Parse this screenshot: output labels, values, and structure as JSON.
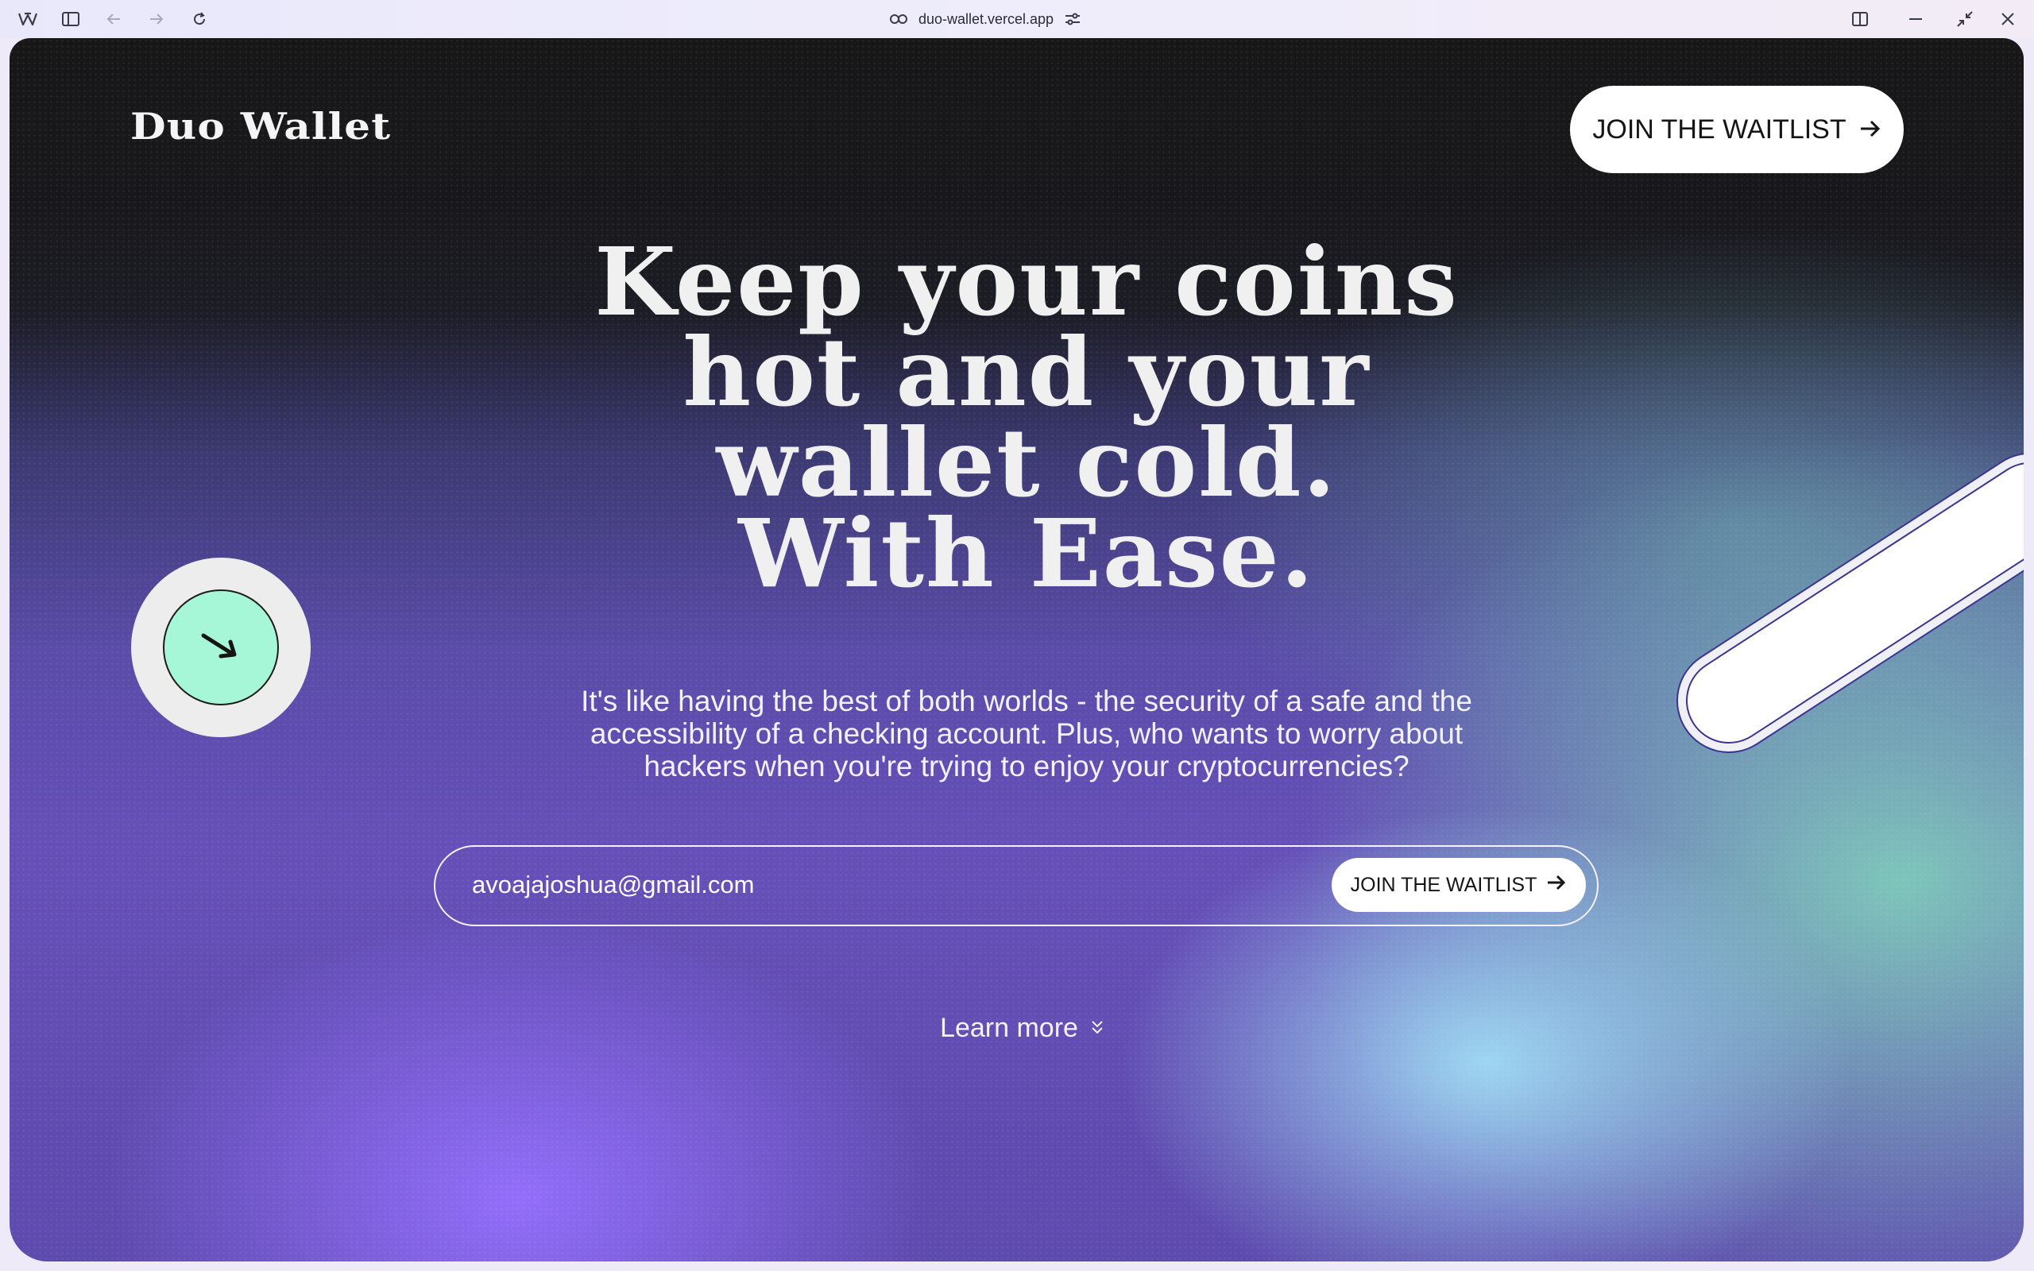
{
  "browser": {
    "url": "duo-wallet.vercel.app",
    "icons": [
      "app-logo-icon",
      "sidebar-toggle-icon",
      "back-icon",
      "forward-icon",
      "reload-icon",
      "link-icon",
      "site-settings-icon",
      "split-view-icon",
      "minimize-icon",
      "restore-icon",
      "close-icon"
    ]
  },
  "header": {
    "logo": "Duo Wallet",
    "cta_label": "JOIN THE WAITLIST"
  },
  "hero": {
    "lines": [
      "Keep your coins",
      "hot and your",
      "wallet cold.",
      "With Ease."
    ]
  },
  "subtitle": {
    "lines": [
      "It's like having the best of both worlds - the security of a safe and the",
      "accessibility of a checking account. Plus, who wants to worry about",
      "hackers when you're trying to enjoy your cryptocurrencies?"
    ]
  },
  "form": {
    "email_value": "avoajajoshua@gmail.com",
    "button_label": "JOIN THE WAITLIST"
  },
  "learn_more": {
    "label": "Learn more"
  },
  "colors": {
    "accent_mint": "#a6f6d8",
    "purple": "#6650b8",
    "dark_top": "#171718"
  }
}
